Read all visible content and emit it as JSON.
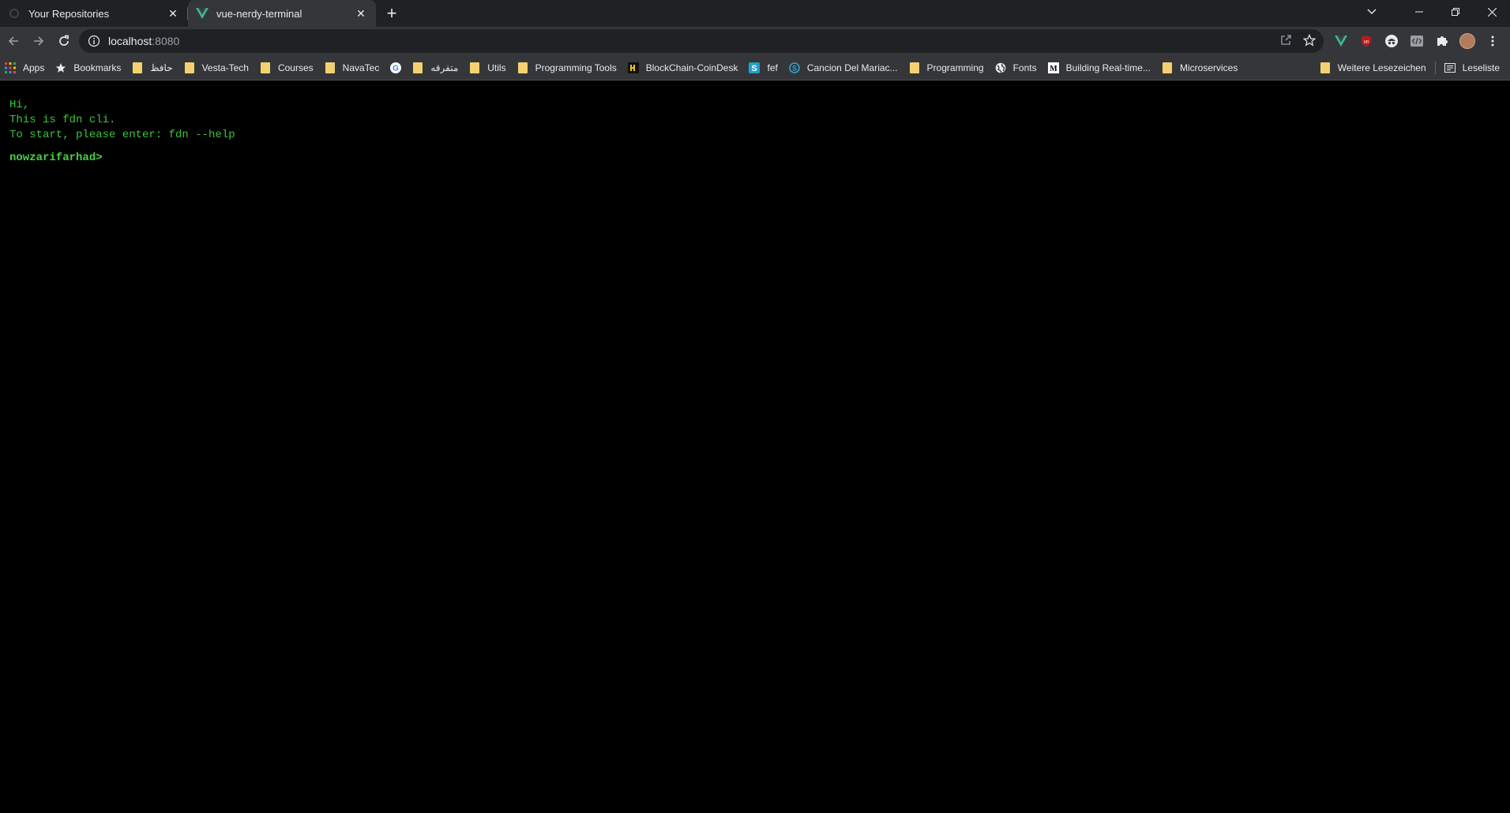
{
  "tabs": [
    {
      "title": "Your Repositories",
      "favicon": "github-icon",
      "active": false
    },
    {
      "title": "vue-nerdy-terminal",
      "favicon": "vue-icon",
      "active": true
    }
  ],
  "address_bar": {
    "host": "localhost",
    "port": ":8080"
  },
  "bookmarks": [
    {
      "label": "Apps",
      "icon": "apps-grid-icon"
    },
    {
      "label": "Bookmarks",
      "icon": "star-icon"
    },
    {
      "label": "حافظ",
      "icon": "folder-icon"
    },
    {
      "label": "Vesta-Tech",
      "icon": "folder-icon"
    },
    {
      "label": "Courses",
      "icon": "folder-icon"
    },
    {
      "label": "NavaTec",
      "icon": "folder-icon"
    },
    {
      "label": "",
      "icon": "google-icon"
    },
    {
      "label": "متفرقه",
      "icon": "folder-icon"
    },
    {
      "label": "Utils",
      "icon": "folder-icon"
    },
    {
      "label": "Programming Tools",
      "icon": "folder-icon"
    },
    {
      "label": "BlockChain-CoinDesk",
      "icon": "coindesk-icon"
    },
    {
      "label": "fef",
      "icon": "s-icon"
    },
    {
      "label": "Cancion Del Mariac...",
      "icon": "refresh-s-icon"
    },
    {
      "label": "Programming",
      "icon": "folder-icon"
    },
    {
      "label": "Fonts",
      "icon": "globe-icon"
    },
    {
      "label": "Building Real-time...",
      "icon": "medium-icon"
    },
    {
      "label": "Microservices",
      "icon": "folder-icon"
    }
  ],
  "bookmarks_right": {
    "other": "Weitere Lesezeichen",
    "reading_list": "Leseliste"
  },
  "terminal": {
    "lines": [
      "Hi,",
      "This is fdn cli.",
      "To start, please enter: fdn --help"
    ],
    "prompt": "nowzarifarhad>"
  },
  "colors": {
    "terminal_text": "#3bc43b",
    "terminal_bg": "#000000",
    "chrome_bg": "#35363a",
    "tabstrip_bg": "#202124"
  }
}
